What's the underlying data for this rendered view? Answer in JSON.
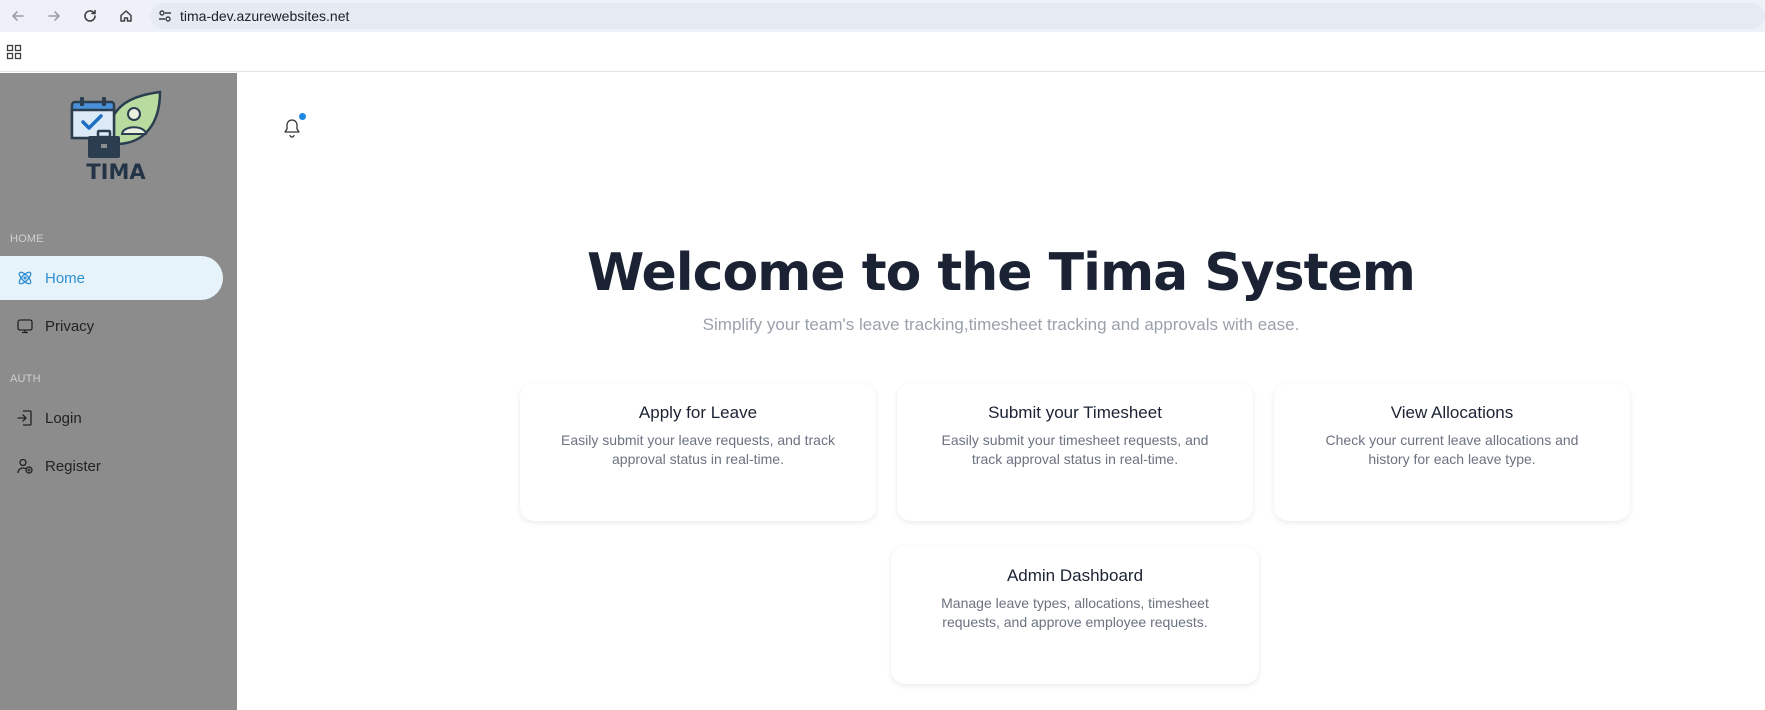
{
  "browser": {
    "url": "tima-dev.azurewebsites.net",
    "icons": [
      "back-icon",
      "forward-icon",
      "reload-icon",
      "home-icon",
      "site-info-icon",
      "apps-icon"
    ]
  },
  "sidebar": {
    "logo_text": "TIMA",
    "sections": [
      {
        "label": "HOME"
      },
      {
        "label": "AUTH"
      }
    ],
    "items": [
      {
        "label": "Home",
        "icon": "atom-icon",
        "active": true
      },
      {
        "label": "Privacy",
        "icon": "monitor-icon",
        "active": false
      },
      {
        "label": "Login",
        "icon": "login-icon",
        "active": false
      },
      {
        "label": "Register",
        "icon": "user-plus-icon",
        "active": false
      }
    ]
  },
  "header": {
    "notification_icon": "bell-icon",
    "has_unread": true
  },
  "hero": {
    "title": "Welcome to the Tima System",
    "subtitle": "Simplify your team's leave tracking,timesheet tracking and approvals with ease."
  },
  "cards": [
    {
      "title": "Apply for Leave",
      "desc": "Easily submit your leave requests, and track approval status in real-time."
    },
    {
      "title": "Submit your Timesheet",
      "desc": "Easily submit your timesheet requests, and track approval status in real-time."
    },
    {
      "title": "View Allocations",
      "desc": "Check your current leave allocations and history for each leave type."
    },
    {
      "title": "Admin Dashboard",
      "desc": "Manage leave types, allocations, timesheet requests, and approve employee requests."
    }
  ],
  "colors": {
    "sidebar_bg": "#8c8c8c",
    "active_bg": "#e7f3fb",
    "accent": "#2f8fd3",
    "title": "#1a2233"
  }
}
